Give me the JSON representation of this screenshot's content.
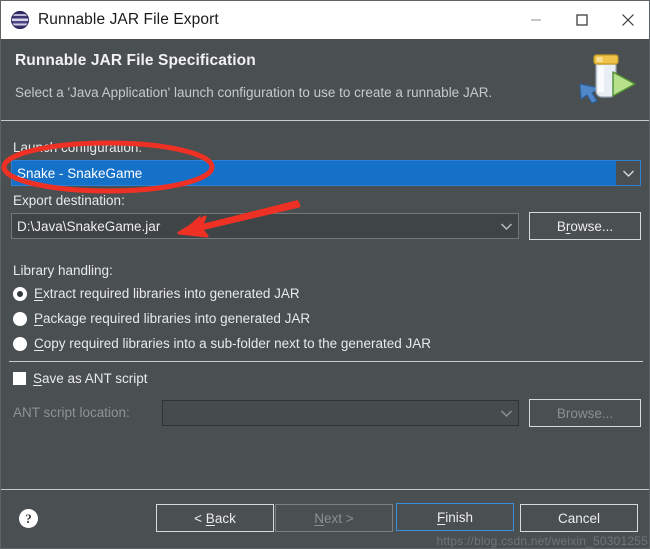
{
  "window": {
    "title": "Runnable JAR File Export",
    "icon": "eclipse-sphere-icon",
    "controls": {
      "minimize": "minimize-icon",
      "maximize": "maximize-icon",
      "close": "close-icon"
    }
  },
  "header": {
    "title": "Runnable JAR File Specification",
    "description": "Select a 'Java Application' launch configuration to use to create a runnable JAR.",
    "icon": "runnable-jar-icon"
  },
  "form": {
    "launch_configuration": {
      "label": "Launch configuration:",
      "value": "Snake - SnakeGame",
      "selected": true,
      "dropdown_icon": "chevron-down-icon"
    },
    "export_destination": {
      "label": "Export destination:",
      "value": "D:\\Java\\SnakeGame.jar",
      "dropdown_icon": "chevron-down-icon",
      "browse_label": "Browse...",
      "browse_mnemonic": "r"
    },
    "library_handling": {
      "label": "Library handling:",
      "options": [
        {
          "label": "Extract required libraries into generated JAR",
          "mnemonic": "E",
          "selected": true
        },
        {
          "label": "Package required libraries into generated JAR",
          "mnemonic": "P",
          "selected": false
        },
        {
          "label": "Copy required libraries into a sub-folder next to the generated JAR",
          "mnemonic": "C",
          "selected": false
        }
      ]
    },
    "save_as_ant_script": {
      "label": "Save as ANT script",
      "mnemonic": "S",
      "checked": false
    },
    "ant_script_location": {
      "label": "ANT script location:",
      "value": "",
      "disabled": true,
      "dropdown_icon": "chevron-down-icon",
      "browse_label": "Browse...",
      "browse_mnemonic": "r"
    }
  },
  "footer": {
    "help_icon": "help-question-icon",
    "buttons": [
      {
        "label": "< Back",
        "mnemonic": "B",
        "disabled": false,
        "focused": false
      },
      {
        "label": "Next >",
        "mnemonic": "N",
        "disabled": true,
        "focused": false
      },
      {
        "label": "Finish",
        "mnemonic": "F",
        "disabled": false,
        "focused": true
      },
      {
        "label": "Cancel",
        "mnemonic": "",
        "disabled": false,
        "focused": false
      }
    ]
  },
  "watermark": {
    "text": "https://blog.csdn.net/weixin_50301255"
  },
  "annotations": {
    "ellipse": {
      "label": "red-ellipse-highlight",
      "color": "#ee3124"
    },
    "arrow": {
      "label": "red-arrow-pointer",
      "color": "#ee3124"
    }
  },
  "colors": {
    "dialog_bg": "#4a4f52",
    "titlebar_bg": "#ffffff",
    "accent_selection": "#1570c8",
    "focus_border": "#3d8ddd",
    "annotation_red": "#ee3124"
  }
}
